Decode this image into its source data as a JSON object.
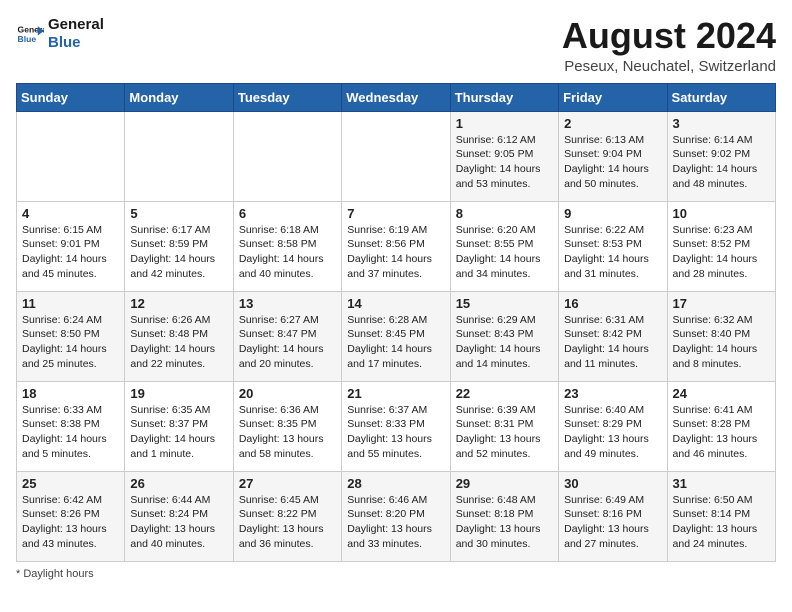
{
  "header": {
    "logo_line1": "General",
    "logo_line2": "Blue",
    "month_title": "August 2024",
    "location": "Peseux, Neuchatel, Switzerland"
  },
  "days_of_week": [
    "Sunday",
    "Monday",
    "Tuesday",
    "Wednesday",
    "Thursday",
    "Friday",
    "Saturday"
  ],
  "weeks": [
    [
      {
        "num": "",
        "info": ""
      },
      {
        "num": "",
        "info": ""
      },
      {
        "num": "",
        "info": ""
      },
      {
        "num": "",
        "info": ""
      },
      {
        "num": "1",
        "info": "Sunrise: 6:12 AM\nSunset: 9:05 PM\nDaylight: 14 hours\nand 53 minutes."
      },
      {
        "num": "2",
        "info": "Sunrise: 6:13 AM\nSunset: 9:04 PM\nDaylight: 14 hours\nand 50 minutes."
      },
      {
        "num": "3",
        "info": "Sunrise: 6:14 AM\nSunset: 9:02 PM\nDaylight: 14 hours\nand 48 minutes."
      }
    ],
    [
      {
        "num": "4",
        "info": "Sunrise: 6:15 AM\nSunset: 9:01 PM\nDaylight: 14 hours\nand 45 minutes."
      },
      {
        "num": "5",
        "info": "Sunrise: 6:17 AM\nSunset: 8:59 PM\nDaylight: 14 hours\nand 42 minutes."
      },
      {
        "num": "6",
        "info": "Sunrise: 6:18 AM\nSunset: 8:58 PM\nDaylight: 14 hours\nand 40 minutes."
      },
      {
        "num": "7",
        "info": "Sunrise: 6:19 AM\nSunset: 8:56 PM\nDaylight: 14 hours\nand 37 minutes."
      },
      {
        "num": "8",
        "info": "Sunrise: 6:20 AM\nSunset: 8:55 PM\nDaylight: 14 hours\nand 34 minutes."
      },
      {
        "num": "9",
        "info": "Sunrise: 6:22 AM\nSunset: 8:53 PM\nDaylight: 14 hours\nand 31 minutes."
      },
      {
        "num": "10",
        "info": "Sunrise: 6:23 AM\nSunset: 8:52 PM\nDaylight: 14 hours\nand 28 minutes."
      }
    ],
    [
      {
        "num": "11",
        "info": "Sunrise: 6:24 AM\nSunset: 8:50 PM\nDaylight: 14 hours\nand 25 minutes."
      },
      {
        "num": "12",
        "info": "Sunrise: 6:26 AM\nSunset: 8:48 PM\nDaylight: 14 hours\nand 22 minutes."
      },
      {
        "num": "13",
        "info": "Sunrise: 6:27 AM\nSunset: 8:47 PM\nDaylight: 14 hours\nand 20 minutes."
      },
      {
        "num": "14",
        "info": "Sunrise: 6:28 AM\nSunset: 8:45 PM\nDaylight: 14 hours\nand 17 minutes."
      },
      {
        "num": "15",
        "info": "Sunrise: 6:29 AM\nSunset: 8:43 PM\nDaylight: 14 hours\nand 14 minutes."
      },
      {
        "num": "16",
        "info": "Sunrise: 6:31 AM\nSunset: 8:42 PM\nDaylight: 14 hours\nand 11 minutes."
      },
      {
        "num": "17",
        "info": "Sunrise: 6:32 AM\nSunset: 8:40 PM\nDaylight: 14 hours\nand 8 minutes."
      }
    ],
    [
      {
        "num": "18",
        "info": "Sunrise: 6:33 AM\nSunset: 8:38 PM\nDaylight: 14 hours\nand 5 minutes."
      },
      {
        "num": "19",
        "info": "Sunrise: 6:35 AM\nSunset: 8:37 PM\nDaylight: 14 hours\nand 1 minute."
      },
      {
        "num": "20",
        "info": "Sunrise: 6:36 AM\nSunset: 8:35 PM\nDaylight: 13 hours\nand 58 minutes."
      },
      {
        "num": "21",
        "info": "Sunrise: 6:37 AM\nSunset: 8:33 PM\nDaylight: 13 hours\nand 55 minutes."
      },
      {
        "num": "22",
        "info": "Sunrise: 6:39 AM\nSunset: 8:31 PM\nDaylight: 13 hours\nand 52 minutes."
      },
      {
        "num": "23",
        "info": "Sunrise: 6:40 AM\nSunset: 8:29 PM\nDaylight: 13 hours\nand 49 minutes."
      },
      {
        "num": "24",
        "info": "Sunrise: 6:41 AM\nSunset: 8:28 PM\nDaylight: 13 hours\nand 46 minutes."
      }
    ],
    [
      {
        "num": "25",
        "info": "Sunrise: 6:42 AM\nSunset: 8:26 PM\nDaylight: 13 hours\nand 43 minutes."
      },
      {
        "num": "26",
        "info": "Sunrise: 6:44 AM\nSunset: 8:24 PM\nDaylight: 13 hours\nand 40 minutes."
      },
      {
        "num": "27",
        "info": "Sunrise: 6:45 AM\nSunset: 8:22 PM\nDaylight: 13 hours\nand 36 minutes."
      },
      {
        "num": "28",
        "info": "Sunrise: 6:46 AM\nSunset: 8:20 PM\nDaylight: 13 hours\nand 33 minutes."
      },
      {
        "num": "29",
        "info": "Sunrise: 6:48 AM\nSunset: 8:18 PM\nDaylight: 13 hours\nand 30 minutes."
      },
      {
        "num": "30",
        "info": "Sunrise: 6:49 AM\nSunset: 8:16 PM\nDaylight: 13 hours\nand 27 minutes."
      },
      {
        "num": "31",
        "info": "Sunrise: 6:50 AM\nSunset: 8:14 PM\nDaylight: 13 hours\nand 24 minutes."
      }
    ]
  ],
  "footer": {
    "note": "Daylight hours"
  }
}
